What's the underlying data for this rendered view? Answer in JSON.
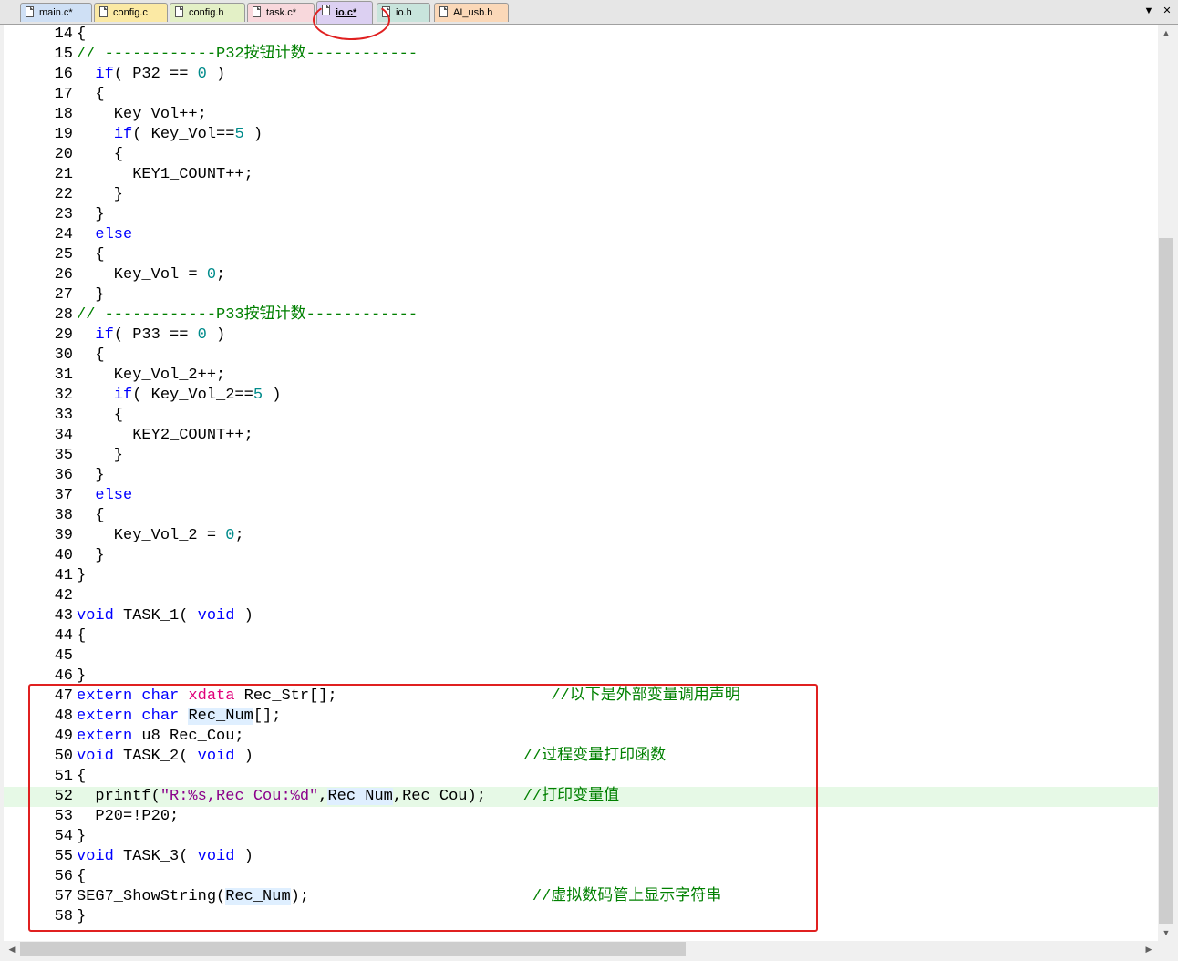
{
  "tabs": [
    {
      "label": "main.c*",
      "color": "#cfe0f5"
    },
    {
      "label": "config.c",
      "color": "#fbe9a4"
    },
    {
      "label": "config.h",
      "color": "#e3f0c6"
    },
    {
      "label": "task.c*",
      "color": "#f8d8dc"
    },
    {
      "label": "io.c*",
      "color": "#dcd0f2",
      "active": true
    },
    {
      "label": "io.h",
      "color": "#c8e4dc"
    },
    {
      "label": "AI_usb.h",
      "color": "#fbd8b8"
    }
  ],
  "tab_controls": {
    "menu_icon": "chevron-down-icon",
    "close_icon": "close-icon",
    "menu_glyph": "▼",
    "close_glyph": "✕"
  },
  "annotations": {
    "color": "#e02020"
  },
  "editor": {
    "current_line": 52,
    "lines": [
      {
        "n": "14",
        "html": "{"
      },
      {
        "n": "15",
        "html": "<span class=\"cm\">// ------------P32按钮计数------------</span>"
      },
      {
        "n": "16",
        "html": "  <span class=\"kw\">if</span>( P32 == <span class=\"num\">0</span> )"
      },
      {
        "n": "17",
        "html": "  {"
      },
      {
        "n": "18",
        "html": "    Key_Vol++;"
      },
      {
        "n": "19",
        "html": "    <span class=\"kw\">if</span>( Key_Vol==<span class=\"num\">5</span> )"
      },
      {
        "n": "20",
        "html": "    {"
      },
      {
        "n": "21",
        "html": "      KEY1_COUNT++;"
      },
      {
        "n": "22",
        "html": "    }"
      },
      {
        "n": "23",
        "html": "  }"
      },
      {
        "n": "24",
        "html": "  <span class=\"kw\">else</span>"
      },
      {
        "n": "25",
        "html": "  {"
      },
      {
        "n": "26",
        "html": "    Key_Vol = <span class=\"num\">0</span>;"
      },
      {
        "n": "27",
        "html": "  }"
      },
      {
        "n": "28",
        "html": "<span class=\"cm\">// ------------P33按钮计数------------</span>"
      },
      {
        "n": "29",
        "html": "  <span class=\"kw\">if</span>( P33 == <span class=\"num\">0</span> )"
      },
      {
        "n": "30",
        "html": "  {"
      },
      {
        "n": "31",
        "html": "    Key_Vol_2++;"
      },
      {
        "n": "32",
        "html": "    <span class=\"kw\">if</span>( Key_Vol_2==<span class=\"num\">5</span> )"
      },
      {
        "n": "33",
        "html": "    {"
      },
      {
        "n": "34",
        "html": "      KEY2_COUNT++;"
      },
      {
        "n": "35",
        "html": "    }"
      },
      {
        "n": "36",
        "html": "  }"
      },
      {
        "n": "37",
        "html": "  <span class=\"kw\">else</span>"
      },
      {
        "n": "38",
        "html": "  {"
      },
      {
        "n": "39",
        "html": "    Key_Vol_2 = <span class=\"num\">0</span>;"
      },
      {
        "n": "40",
        "html": "  }"
      },
      {
        "n": "41",
        "html": "}"
      },
      {
        "n": "42",
        "html": ""
      },
      {
        "n": "43",
        "html": "<span class=\"kw\">void</span> TASK_1( <span class=\"kw\">void</span> )"
      },
      {
        "n": "44",
        "html": "{"
      },
      {
        "n": "45",
        "html": ""
      },
      {
        "n": "46",
        "html": "}"
      },
      {
        "n": "47",
        "html": "<span class=\"kw\">extern</span> <span class=\"kw\">char</span> <span class=\"kw2\">xdata</span> Rec_Str[];                       <span class=\"cm\">//以下是外部变量调用声明</span>"
      },
      {
        "n": "48",
        "html": "<span class=\"kw\">extern</span> <span class=\"kw\">char</span> <span class=\"hl\">Rec_Num</span>[];"
      },
      {
        "n": "49",
        "html": "<span class=\"kw\">extern</span> u8 Rec_Cou;"
      },
      {
        "n": "50",
        "html": "<span class=\"kw\">void</span> TASK_2( <span class=\"kw\">void</span> )                             <span class=\"cm\">//过程变量打印函数</span>"
      },
      {
        "n": "51",
        "html": "{"
      },
      {
        "n": "52",
        "html": "  printf(<span class=\"str\">\"R:%s,Rec_Cou:%d\"</span>,<span class=\"hl\">Rec_Num</span>,Rec_Cou);    <span class=\"cm\">//打印变量值</span>"
      },
      {
        "n": "53",
        "html": "  P20=!P20;"
      },
      {
        "n": "54",
        "html": "}"
      },
      {
        "n": "55",
        "html": "<span class=\"kw\">void</span> TASK_3( <span class=\"kw\">void</span> )"
      },
      {
        "n": "56",
        "html": "{"
      },
      {
        "n": "57",
        "html": "SEG7_ShowString(<span class=\"hl\">Rec_Num</span>);                        <span class=\"cm\">//虚拟数码管上显示字符串</span>"
      },
      {
        "n": "58",
        "html": "}"
      }
    ]
  },
  "scrollbars": {
    "up": "▲",
    "down": "▼",
    "left": "◀",
    "right": "▶"
  }
}
